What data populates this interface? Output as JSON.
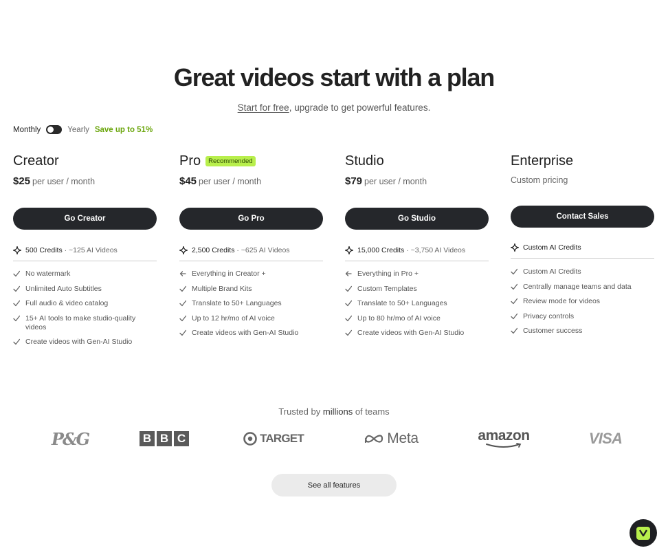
{
  "hero": {
    "title": "Great videos start with a plan",
    "sub_link": "Start for free",
    "sub_rest": ", upgrade to get powerful features."
  },
  "billing": {
    "monthly": "Monthly",
    "yearly": "Yearly",
    "save": "Save up to 51%",
    "toggle_state": "monthly"
  },
  "plans": [
    {
      "name": "Creator",
      "price": "$25",
      "price_unit": "per user / month",
      "cta": "Go Creator",
      "credits": "500 Credits",
      "credits_sub": "· ~125 AI Videos",
      "features": [
        {
          "icon": "check-icon",
          "text": "No watermark"
        },
        {
          "icon": "check-icon",
          "text": "Unlimited Auto Subtitles"
        },
        {
          "icon": "check-icon",
          "text": "Full audio & video catalog"
        },
        {
          "icon": "check-icon",
          "text": "15+ AI tools to make studio-quality videos"
        },
        {
          "icon": "check-icon",
          "text": "Create videos with Gen-AI Studio"
        }
      ]
    },
    {
      "name": "Pro",
      "badge": "Recommended",
      "price": "$45",
      "price_unit": "per user / month",
      "cta": "Go Pro",
      "credits": "2,500 Credits",
      "credits_sub": "· ~625 AI Videos",
      "features": [
        {
          "icon": "arrow-left-icon",
          "text": "Everything in Creator +"
        },
        {
          "icon": "check-icon",
          "text": "Multiple Brand Kits"
        },
        {
          "icon": "check-icon",
          "text": "Translate to 50+ Languages"
        },
        {
          "icon": "check-icon",
          "text": "Up to 12 hr/mo of AI voice"
        },
        {
          "icon": "check-icon",
          "text": "Create videos with Gen-AI Studio"
        }
      ]
    },
    {
      "name": "Studio",
      "price": "$79",
      "price_unit": "per user / month",
      "cta": "Go Studio",
      "credits": "15,000 Credits",
      "credits_sub": "· ~3,750 AI Videos",
      "features": [
        {
          "icon": "arrow-left-icon",
          "text": "Everything in Pro +"
        },
        {
          "icon": "check-icon",
          "text": "Custom Templates"
        },
        {
          "icon": "check-icon",
          "text": "Translate to 50+ Languages"
        },
        {
          "icon": "check-icon",
          "text": "Up to 80 hr/mo of AI voice"
        },
        {
          "icon": "check-icon",
          "text": "Create videos with Gen-AI Studio"
        }
      ]
    },
    {
      "name": "Enterprise",
      "price_text": "Custom pricing",
      "cta": "Contact Sales",
      "credits": "Custom AI Credits",
      "features": [
        {
          "icon": "check-icon",
          "text": "Custom AI Credits"
        },
        {
          "icon": "check-icon",
          "text": "Centrally manage teams and data"
        },
        {
          "icon": "check-icon",
          "text": "Review mode for videos"
        },
        {
          "icon": "check-icon",
          "text": "Privacy controls"
        },
        {
          "icon": "check-icon",
          "text": "Customer success"
        }
      ]
    }
  ],
  "trusted": {
    "prefix": "Trusted by",
    "highlight": "millions",
    "suffix": "of teams"
  },
  "logos": [
    {
      "name": "P&G",
      "icon": "pg-logo"
    },
    {
      "name": "BBC",
      "icon": "bbc-logo"
    },
    {
      "name": "TARGET",
      "icon": "target-logo"
    },
    {
      "name": "Meta",
      "icon": "meta-logo"
    },
    {
      "name": "amazon",
      "icon": "amazon-logo"
    },
    {
      "name": "VISA",
      "icon": "visa-logo"
    }
  ],
  "see_all": "See all features",
  "chat_icon": "chat-widget-icon",
  "colors": {
    "accent": "#b8ef4c",
    "save_text": "#6aa50b",
    "button_dark": "#25272b"
  }
}
